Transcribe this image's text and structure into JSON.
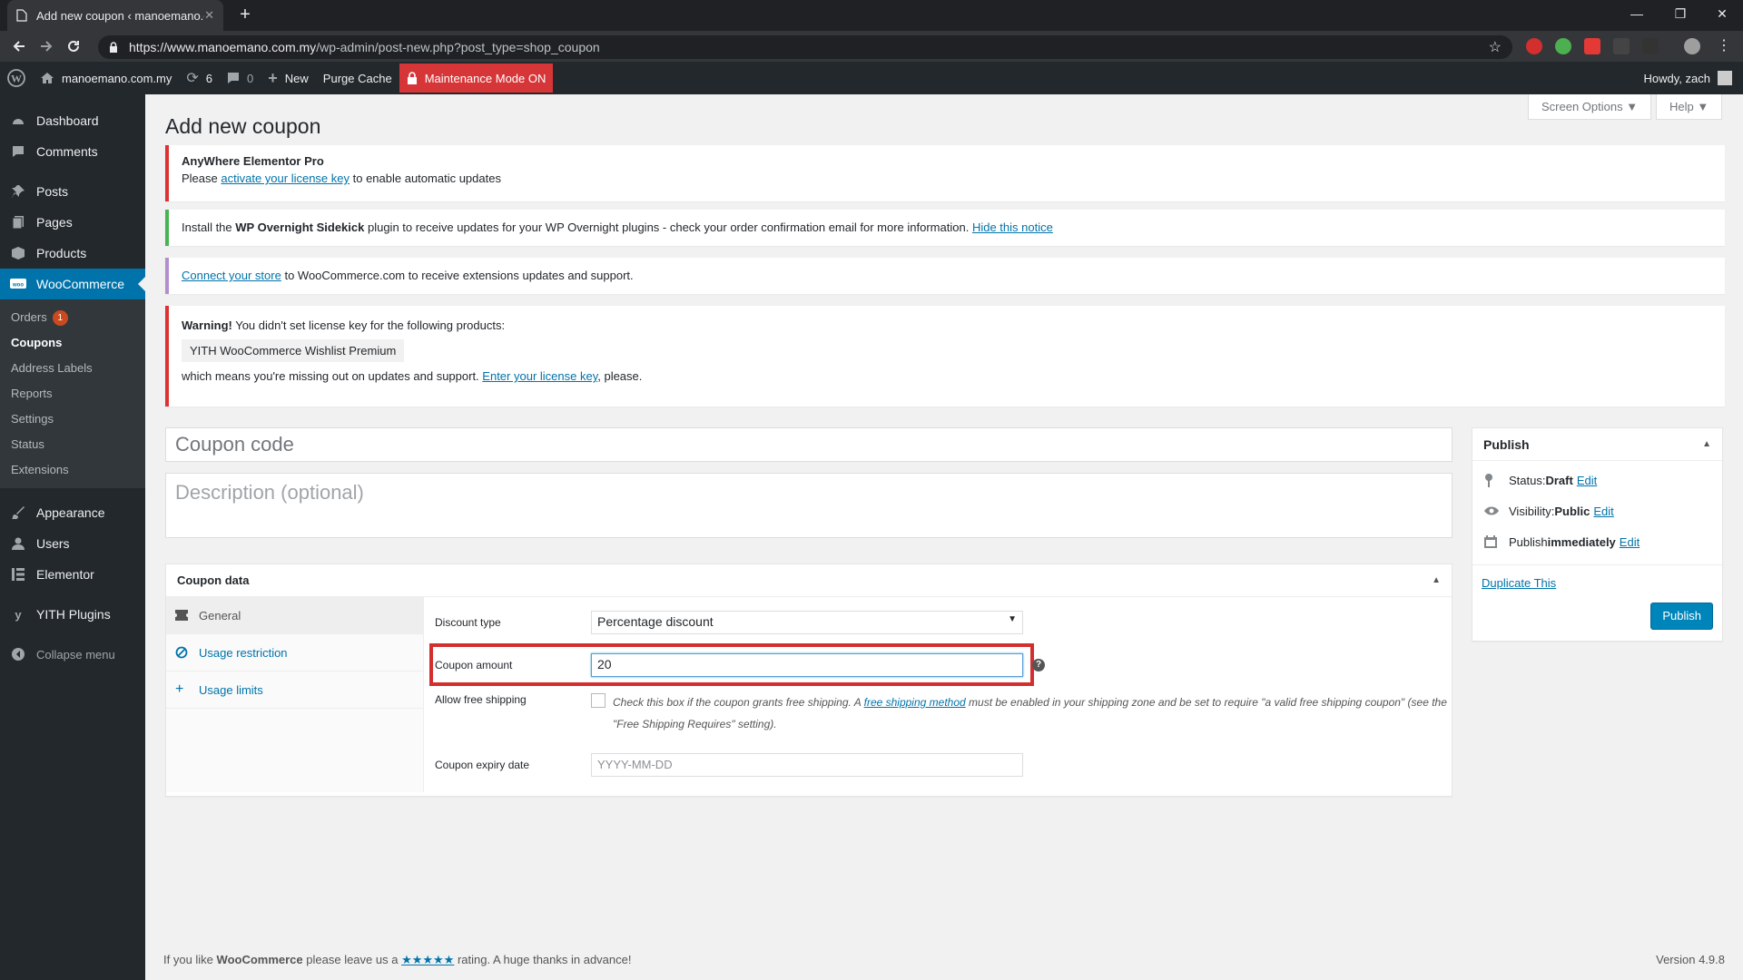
{
  "browser": {
    "tab_title": "Add new coupon ‹ manoemano.c",
    "url_host": "https://www.manoemano.com.my",
    "url_path": "/wp-admin/post-new.php?post_type=shop_coupon"
  },
  "adminbar": {
    "site": "manoemano.com.my",
    "updates": "6",
    "comments": "0",
    "new": "New",
    "purge": "Purge Cache",
    "maintenance": "Maintenance Mode ON",
    "howdy": "Howdy, zach"
  },
  "sidebar": {
    "dashboard": "Dashboard",
    "comments": "Comments",
    "posts": "Posts",
    "pages": "Pages",
    "products": "Products",
    "woocommerce": "WooCommerce",
    "sub": {
      "orders": "Orders",
      "orders_badge": "1",
      "coupons": "Coupons",
      "address_labels": "Address Labels",
      "reports": "Reports",
      "settings": "Settings",
      "status": "Status",
      "extensions": "Extensions"
    },
    "appearance": "Appearance",
    "users": "Users",
    "elementor": "Elementor",
    "yith": "YITH Plugins",
    "collapse": "Collapse menu"
  },
  "header": {
    "screen_options": "Screen Options ▼",
    "help": "Help ▼",
    "title": "Add new coupon"
  },
  "notices": {
    "n1_title": "AnyWhere Elementor Pro",
    "n1_pre": "Please ",
    "n1_link": "activate your license key",
    "n1_post": " to enable automatic updates",
    "n2_pre": "Install the ",
    "n2_bold": "WP Overnight Sidekick",
    "n2_mid": " plugin to receive updates for your WP Overnight plugins - check your order confirmation email for more information. ",
    "n2_link": "Hide this notice",
    "n3_link": "Connect your store",
    "n3_post": " to WooCommerce.com to receive extensions updates and support.",
    "n4_bold": "Warning!",
    "n4_text": " You didn't set license key for the following products:",
    "n4_product": "YITH WooCommerce Wishlist Premium",
    "n4_pre": "which means you're missing out on updates and support. ",
    "n4_link": "Enter your license key",
    "n4_post": ", please."
  },
  "coupon": {
    "code_placeholder": "Coupon code",
    "desc_placeholder": "Description (optional)"
  },
  "coupon_data": {
    "title": "Coupon data",
    "tabs": {
      "general": "General",
      "usage_restriction": "Usage restriction",
      "usage_limits": "Usage limits"
    },
    "discount_type_label": "Discount type",
    "discount_type_value": "Percentage discount",
    "amount_label": "Coupon amount",
    "amount_value": "20",
    "free_ship_label": "Allow free shipping",
    "free_ship_pre": "Check this box if the coupon grants free shipping. A ",
    "free_ship_link": "free shipping method",
    "free_ship_post": " must be enabled in your shipping zone and be set to require \"a valid free shipping coupon\" (see the \"Free Shipping Requires\" setting).",
    "expiry_label": "Coupon expiry date",
    "expiry_placeholder": "YYYY-MM-DD"
  },
  "publish": {
    "title": "Publish",
    "status_label": "Status: ",
    "status_value": "Draft",
    "visibility_label": "Visibility: ",
    "visibility_value": "Public",
    "publish_label": "Publish ",
    "publish_value": "immediately",
    "edit": "Edit",
    "duplicate": "Duplicate This",
    "button": "Publish"
  },
  "footer": {
    "pre": "If you like ",
    "bold": "WooCommerce",
    "mid": " please leave us a ",
    "stars": "★★★★★",
    "post": " rating. A huge thanks in advance!",
    "version": "Version 4.9.8"
  }
}
